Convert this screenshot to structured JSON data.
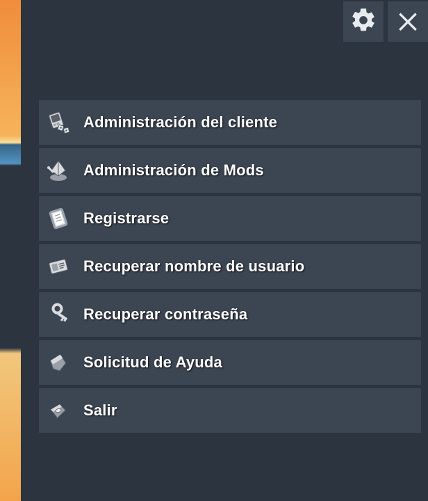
{
  "topbar": {
    "settings_icon": "gear-icon",
    "close_icon": "close-icon"
  },
  "menu": {
    "items": [
      {
        "label": "Administración del cliente",
        "icon": "client-admin-icon"
      },
      {
        "label": "Administración de Mods",
        "icon": "mods-admin-icon"
      },
      {
        "label": "Registrarse",
        "icon": "register-icon"
      },
      {
        "label": "Recuperar nombre de usuario",
        "icon": "recover-username-icon"
      },
      {
        "label": "Recuperar contraseña",
        "icon": "recover-password-icon"
      },
      {
        "label": "Solicitud de Ayuda",
        "icon": "help-request-icon"
      },
      {
        "label": "Salir",
        "icon": "exit-icon"
      }
    ]
  },
  "colors": {
    "panel_bg": "#2c3440",
    "item_bg": "#3c4552",
    "text": "#ffffff",
    "icon_light": "#d9dbde",
    "icon_mid": "#9aa0a8",
    "icon_dark": "#5a616b"
  }
}
